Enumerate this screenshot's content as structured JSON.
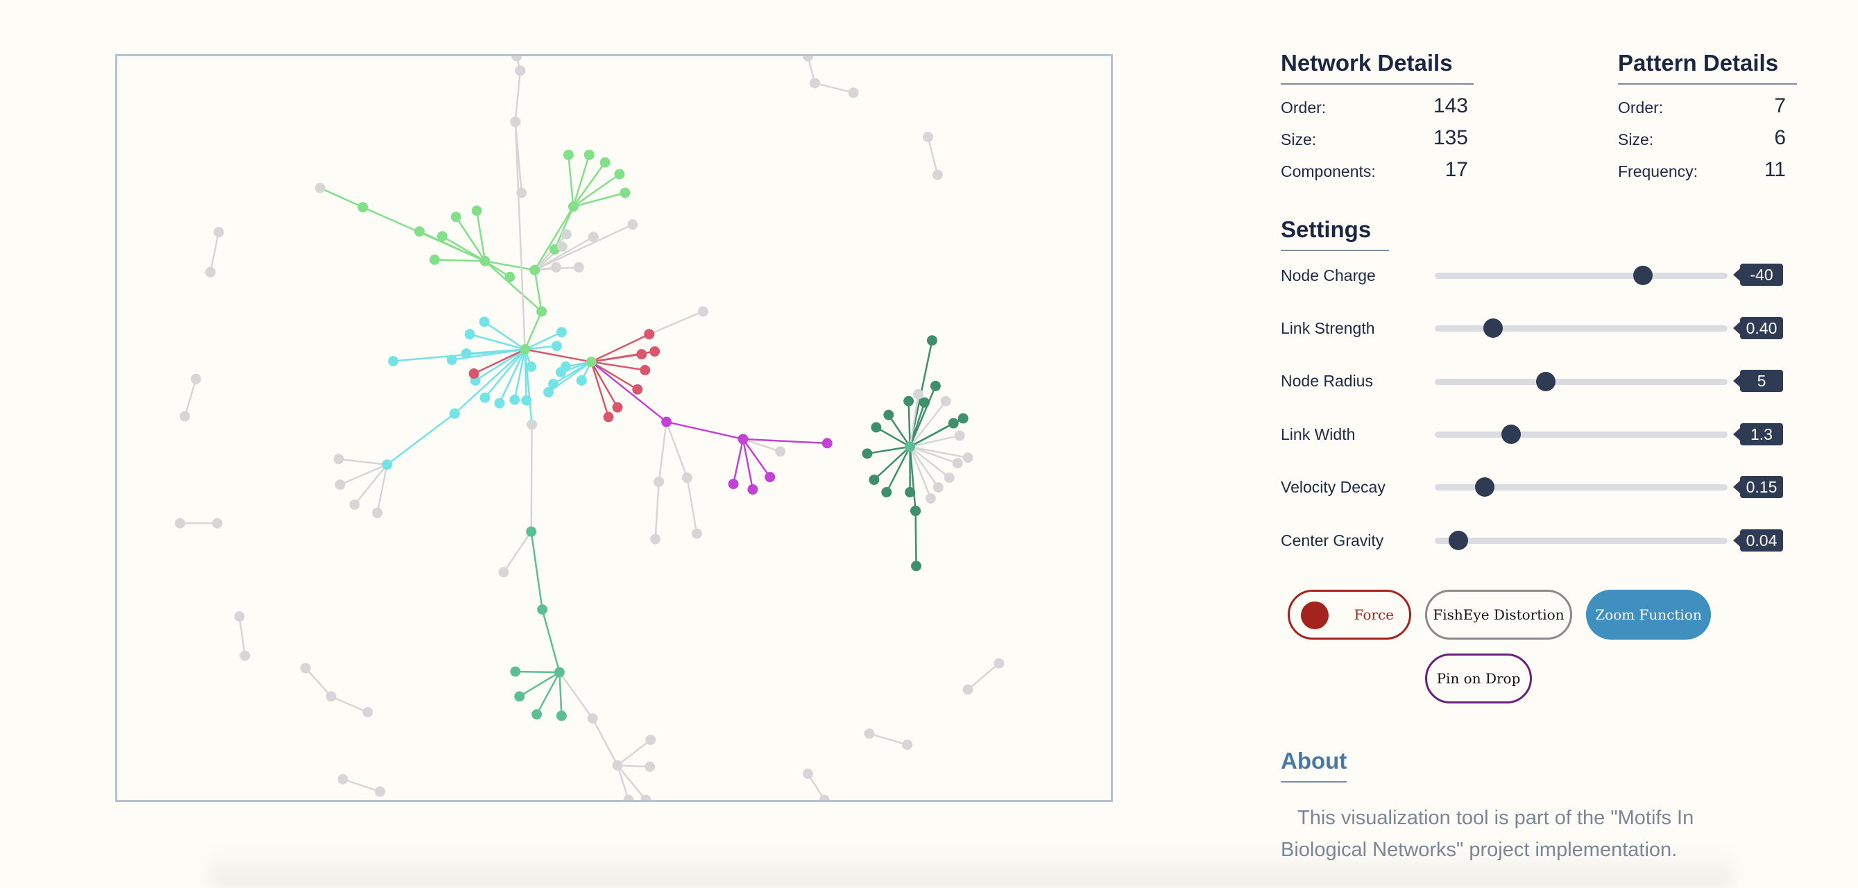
{
  "network_details": {
    "title": "Network Details",
    "order_label": "Order:",
    "order_value": "143",
    "size_label": "Size:",
    "size_value": "135",
    "components_label": "Components:",
    "components_value": "17"
  },
  "pattern_details": {
    "title": "Pattern Details",
    "order_label": "Order:",
    "order_value": "7",
    "size_label": "Size:",
    "size_value": "6",
    "frequency_label": "Frequency:",
    "frequency_value": "11"
  },
  "settings": {
    "title": "Settings",
    "items": [
      {
        "label": "Node Charge",
        "value": "-40",
        "fraction": 0.71
      },
      {
        "label": "Link Strength",
        "value": "0.40",
        "fraction": 0.2
      },
      {
        "label": "Node Radius",
        "value": "5",
        "fraction": 0.38
      },
      {
        "label": "Link Width",
        "value": "1.3",
        "fraction": 0.26
      },
      {
        "label": "Velocity Decay",
        "value": "0.15",
        "fraction": 0.17
      },
      {
        "label": "Center Gravity",
        "value": "0.04",
        "fraction": 0.08
      }
    ]
  },
  "buttons": {
    "force": "Force",
    "fisheye": "FishEye Distortion",
    "zoom": "Zoom Function",
    "pin": "Pin on Drop"
  },
  "about": {
    "title": "About",
    "text": "This visualization tool is part of the \"Motifs In Biological Networks\" project implementation."
  },
  "colors": {
    "gray_node": "#d6d6d6",
    "light_green": "#82df8a",
    "cyan": "#74e3e6",
    "red": "#d9576d",
    "magenta": "#c242d6",
    "teal": "#5cbf94",
    "dark_green": "#3e8f6b",
    "accent_blue": "#3f8fbf",
    "force_red": "#a4231d"
  }
}
